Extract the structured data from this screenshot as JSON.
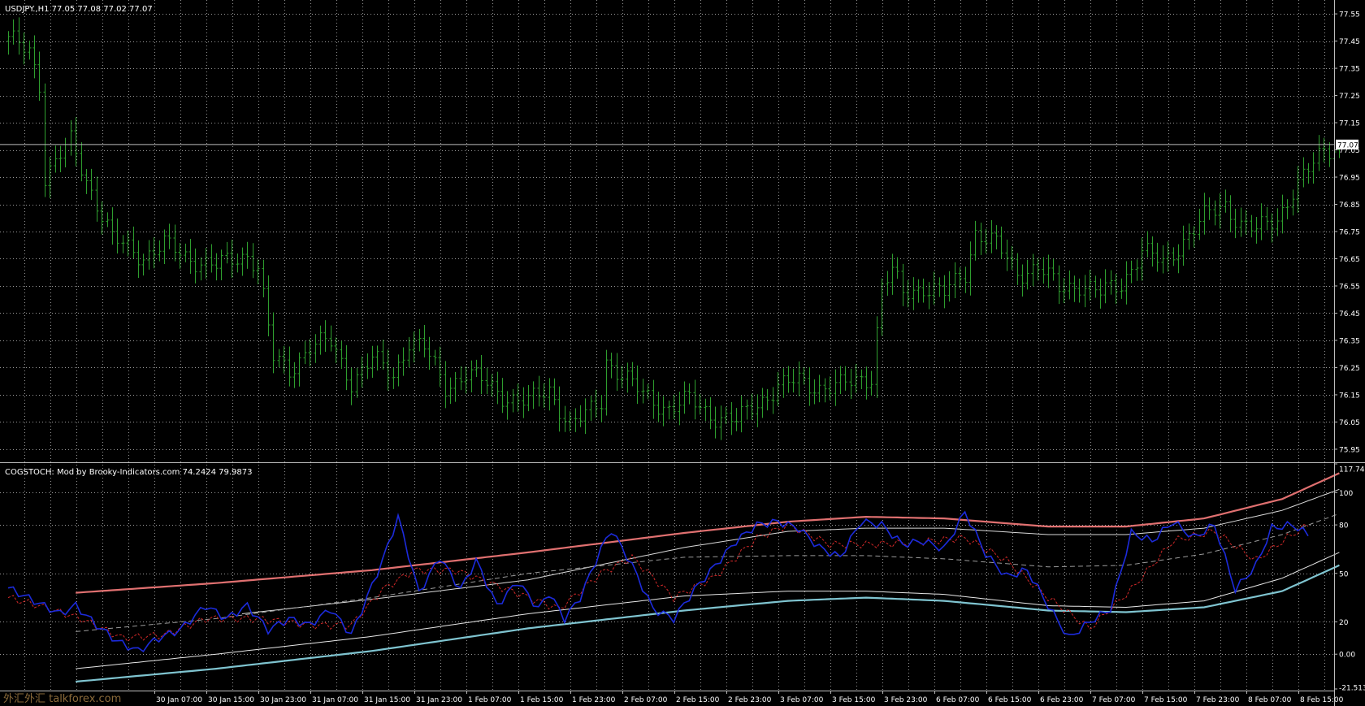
{
  "main_title": "USDJPY.,H1  77.05 77.08 77.02 77.07",
  "indicator_title": "COGSTOCH: Mod by Brooky-Indicators.com 74.2424 79.9873",
  "watermark": "外汇外汇 talkforex.com",
  "colors": {
    "background": "#000000",
    "grid": "#9a9a9a",
    "bars": "#2e9e2e",
    "separator": "#bdbdbd",
    "band_upper": "#e07070",
    "band_upper_inner": "#d8d8d8",
    "band_mid": "#9a9a9a",
    "band_lower_inner": "#e6e6e6",
    "band_lower": "#7fc4d0",
    "stoch": "#1c2bdc",
    "signal": "#d02828"
  },
  "chart_data": [
    {
      "type": "ohlc",
      "symbol": "USDJPY.",
      "timeframe": "H1",
      "last_bar": {
        "open": 77.05,
        "high": 77.08,
        "low": 77.02,
        "close": 77.07
      },
      "current_price": "77.07",
      "ylim": [
        75.905,
        77.595
      ],
      "yticks": [
        "77.55",
        "77.45",
        "77.35",
        "77.25",
        "77.15",
        "77.05",
        "76.95",
        "76.85",
        "76.75",
        "76.65",
        "76.55",
        "76.45",
        "76.35",
        "76.25",
        "76.15",
        "76.05",
        "75.95"
      ],
      "bar_count": 170,
      "anchors": [
        [
          0,
          77.45
        ],
        [
          4,
          77.42
        ],
        [
          6,
          77.3
        ],
        [
          7,
          76.95
        ],
        [
          9,
          77.0
        ],
        [
          12,
          77.08
        ],
        [
          16,
          76.9
        ],
        [
          20,
          76.72
        ],
        [
          26,
          76.66
        ],
        [
          30,
          76.7
        ],
        [
          34,
          76.66
        ],
        [
          40,
          76.62
        ],
        [
          46,
          76.67
        ],
        [
          48,
          76.62
        ],
        [
          51,
          76.28
        ],
        [
          54,
          76.24
        ],
        [
          58,
          76.33
        ],
        [
          62,
          76.34
        ],
        [
          66,
          76.2
        ],
        [
          70,
          76.28
        ],
        [
          74,
          76.22
        ],
        [
          77,
          76.35
        ],
        [
          80,
          76.32
        ],
        [
          84,
          76.18
        ],
        [
          88,
          76.23
        ],
        [
          91,
          76.2
        ],
        [
          95,
          76.15
        ],
        [
          100,
          76.12
        ],
        [
          104,
          76.17
        ],
        [
          108,
          76.04
        ],
        [
          111,
          76.07
        ],
        [
          114,
          76.13
        ],
        [
          115,
          76.28
        ],
        [
          118,
          76.22
        ],
        [
          122,
          76.15
        ],
        [
          127,
          76.1
        ],
        [
          131,
          76.13
        ],
        [
          135,
          76.08
        ],
        [
          140,
          76.05
        ],
        [
          144,
          76.12
        ],
        [
          148,
          76.18
        ],
        [
          152,
          76.2
        ],
        [
          156,
          76.18
        ],
        [
          160,
          76.18
        ],
        [
          164,
          76.21
        ],
        [
          166,
          76.22
        ],
        [
          168,
          76.55
        ],
        [
          170,
          76.6
        ],
        [
          172,
          76.52
        ],
        [
          176,
          76.55
        ],
        [
          180,
          76.52
        ],
        [
          184,
          76.6
        ],
        [
          186,
          76.75
        ],
        [
          190,
          76.7
        ],
        [
          194,
          76.6
        ],
        [
          198,
          76.62
        ],
        [
          202,
          76.54
        ],
        [
          206,
          76.56
        ],
        [
          210,
          76.52
        ],
        [
          214,
          76.56
        ],
        [
          218,
          76.68
        ],
        [
          222,
          76.63
        ],
        [
          226,
          76.72
        ],
        [
          230,
          76.8
        ],
        [
          234,
          76.85
        ],
        [
          237,
          76.78
        ],
        [
          240,
          76.75
        ],
        [
          244,
          76.8
        ],
        [
          247,
          76.9
        ],
        [
          250,
          76.97
        ],
        [
          253,
          77.05
        ],
        [
          256,
          77.07
        ]
      ]
    },
    {
      "type": "line",
      "name": "COGSTOCH",
      "values_shown": [
        "74.2424",
        "79.9873"
      ],
      "ylim": [
        -21.5136,
        117.7469
      ],
      "yticks": [
        "117.7469",
        "100",
        "80",
        "50",
        "20",
        "0.00",
        "-21.5136"
      ],
      "x": [
        "30 Jan 07:00",
        "30 Jan 15:00",
        "30 Jan 23:00",
        "31 Jan 07:00",
        "31 Jan 15:00",
        "31 Jan 23:00",
        "1 Feb 07:00",
        "1 Feb 15:00",
        "1 Feb 23:00",
        "2 Feb 07:00",
        "2 Feb 15:00",
        "2 Feb 23:00",
        "3 Feb 07:00",
        "3 Feb 15:00",
        "3 Feb 23:00",
        "6 Feb 07:00",
        "6 Feb 15:00",
        "6 Feb 23:00",
        "7 Feb 07:00",
        "7 Feb 15:00",
        "7 Feb 23:00",
        "8 Feb 07:00",
        "8 Feb 15:00"
      ],
      "bands": {
        "upper": [
          [
            13,
            38
          ],
          [
            40,
            44
          ],
          [
            70,
            52
          ],
          [
            100,
            63
          ],
          [
            130,
            75
          ],
          [
            150,
            82
          ],
          [
            165,
            85
          ],
          [
            180,
            84
          ],
          [
            200,
            79
          ],
          [
            215,
            79
          ],
          [
            230,
            84
          ],
          [
            245,
            96
          ],
          [
            256,
            112
          ]
        ],
        "upper_inner": [
          [
            45,
            25
          ],
          [
            70,
            34
          ],
          [
            100,
            46
          ],
          [
            130,
            66
          ],
          [
            150,
            76
          ],
          [
            165,
            78
          ],
          [
            180,
            78
          ],
          [
            200,
            74
          ],
          [
            215,
            74
          ],
          [
            230,
            78
          ],
          [
            245,
            89
          ],
          [
            256,
            102
          ]
        ],
        "mid": [
          [
            13,
            14
          ],
          [
            40,
            22
          ],
          [
            70,
            35
          ],
          [
            100,
            50
          ],
          [
            130,
            60
          ],
          [
            150,
            61
          ],
          [
            165,
            61
          ],
          [
            180,
            59
          ],
          [
            200,
            54
          ],
          [
            215,
            55
          ],
          [
            230,
            62
          ],
          [
            245,
            74
          ],
          [
            256,
            87
          ]
        ],
        "lower_inner": [
          [
            13,
            -9
          ],
          [
            40,
            0
          ],
          [
            70,
            11
          ],
          [
            100,
            25
          ],
          [
            130,
            36
          ],
          [
            150,
            39
          ],
          [
            165,
            39
          ],
          [
            180,
            37
          ],
          [
            200,
            30
          ],
          [
            215,
            29
          ],
          [
            230,
            33
          ],
          [
            245,
            47
          ],
          [
            256,
            63
          ]
        ],
        "lower": [
          [
            13,
            -17
          ],
          [
            40,
            -9
          ],
          [
            70,
            2
          ],
          [
            100,
            16
          ],
          [
            130,
            27
          ],
          [
            150,
            33
          ],
          [
            165,
            35
          ],
          [
            180,
            33
          ],
          [
            200,
            27
          ],
          [
            215,
            26
          ],
          [
            230,
            29
          ],
          [
            245,
            39
          ],
          [
            256,
            55
          ]
        ]
      },
      "stoch": [
        [
          0,
          41
        ],
        [
          5,
          33
        ],
        [
          10,
          25
        ],
        [
          13,
          30
        ],
        [
          17,
          18
        ],
        [
          21,
          8
        ],
        [
          25,
          2
        ],
        [
          29,
          10
        ],
        [
          33,
          15
        ],
        [
          38,
          30
        ],
        [
          42,
          22
        ],
        [
          46,
          30
        ],
        [
          50,
          15
        ],
        [
          54,
          22
        ],
        [
          58,
          18
        ],
        [
          62,
          28
        ],
        [
          66,
          12
        ],
        [
          69,
          35
        ],
        [
          72,
          58
        ],
        [
          75,
          85
        ],
        [
          79,
          38
        ],
        [
          83,
          60
        ],
        [
          87,
          40
        ],
        [
          90,
          58
        ],
        [
          94,
          30
        ],
        [
          98,
          45
        ],
        [
          102,
          28
        ],
        [
          104,
          38
        ],
        [
          107,
          22
        ],
        [
          110,
          35
        ],
        [
          114,
          65
        ],
        [
          116,
          77
        ],
        [
          120,
          55
        ],
        [
          124,
          28
        ],
        [
          128,
          22
        ],
        [
          132,
          40
        ],
        [
          136,
          55
        ],
        [
          140,
          70
        ],
        [
          144,
          80
        ],
        [
          148,
          82
        ],
        [
          152,
          78
        ],
        [
          156,
          66
        ],
        [
          160,
          60
        ],
        [
          164,
          82
        ],
        [
          168,
          80
        ],
        [
          172,
          68
        ],
        [
          176,
          70
        ],
        [
          180,
          65
        ],
        [
          184,
          88
        ],
        [
          188,
          62
        ],
        [
          192,
          48
        ],
        [
          196,
          52
        ],
        [
          200,
          30
        ],
        [
          204,
          10
        ],
        [
          208,
          20
        ],
        [
          212,
          28
        ],
        [
          216,
          75
        ],
        [
          220,
          70
        ],
        [
          224,
          82
        ],
        [
          228,
          72
        ],
        [
          232,
          80
        ],
        [
          236,
          40
        ],
        [
          240,
          55
        ],
        [
          243,
          78
        ],
        [
          247,
          80
        ],
        [
          250,
          74
        ]
      ],
      "signal": [
        [
          0,
          35
        ],
        [
          6,
          30
        ],
        [
          14,
          22
        ],
        [
          22,
          10
        ],
        [
          30,
          12
        ],
        [
          38,
          22
        ],
        [
          48,
          22
        ],
        [
          58,
          18
        ],
        [
          66,
          18
        ],
        [
          72,
          40
        ],
        [
          78,
          52
        ],
        [
          86,
          52
        ],
        [
          96,
          40
        ],
        [
          106,
          28
        ],
        [
          114,
          50
        ],
        [
          120,
          60
        ],
        [
          128,
          35
        ],
        [
          136,
          48
        ],
        [
          144,
          72
        ],
        [
          150,
          80
        ],
        [
          158,
          68
        ],
        [
          166,
          68
        ],
        [
          174,
          69
        ],
        [
          184,
          72
        ],
        [
          192,
          58
        ],
        [
          200,
          35
        ],
        [
          208,
          16
        ],
        [
          216,
          40
        ],
        [
          224,
          70
        ],
        [
          232,
          76
        ],
        [
          240,
          58
        ],
        [
          246,
          72
        ],
        [
          250,
          80
        ]
      ]
    }
  ]
}
